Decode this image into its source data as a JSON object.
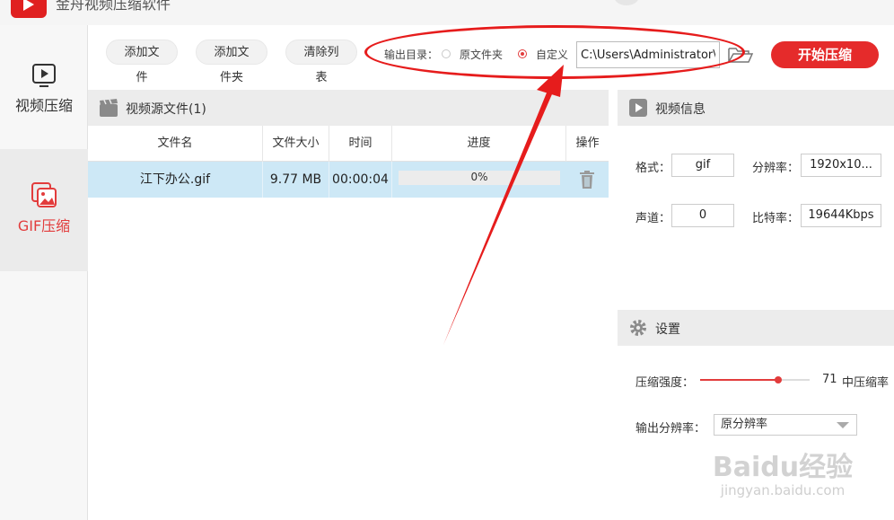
{
  "app": {
    "title": "金舟视频压缩软件"
  },
  "sidebar": {
    "items": [
      {
        "label": "视频压缩"
      },
      {
        "label": "GIF压缩"
      }
    ]
  },
  "toolbar": {
    "add_file": "添加文件",
    "add_folder": "添加文件夹",
    "clear_list": "清除列表",
    "output_dir_label": "输出目录：",
    "radio_original": "原文件夹",
    "radio_custom": "自定义",
    "output_path": "C:\\Users\\Administrator\\",
    "start_button": "开始压缩"
  },
  "file_panel": {
    "title": "视频源文件(1)",
    "columns": [
      "文件名",
      "文件大小",
      "时间",
      "进度",
      "操作"
    ],
    "rows": [
      {
        "name": "江下办公.gif",
        "size": "9.77 MB",
        "duration": "00:00:04",
        "progress_text": "0%",
        "progress": 0
      }
    ]
  },
  "video_info": {
    "title": "视频信息",
    "format_label": "格式：",
    "format": "gif",
    "resolution_label": "分辨率：",
    "resolution": "1920x10...",
    "channel_label": "声道：",
    "channel": "0",
    "bitrate_label": "比特率：",
    "bitrate": "19644Kbps"
  },
  "settings": {
    "title": "设置",
    "compression_label": "压缩强度：",
    "compression_value": "71",
    "compression_level": 71,
    "compression_desc": "中压缩率",
    "output_res_label": "输出分辨率：",
    "output_res_value": "原分辨率"
  },
  "watermark": {
    "text": "Baidu经验",
    "url": "jingyan.baidu.com"
  },
  "colors": {
    "accent": "#e52b2b",
    "selected_row": "#cde8f6",
    "annotation": "#e61c1c"
  }
}
